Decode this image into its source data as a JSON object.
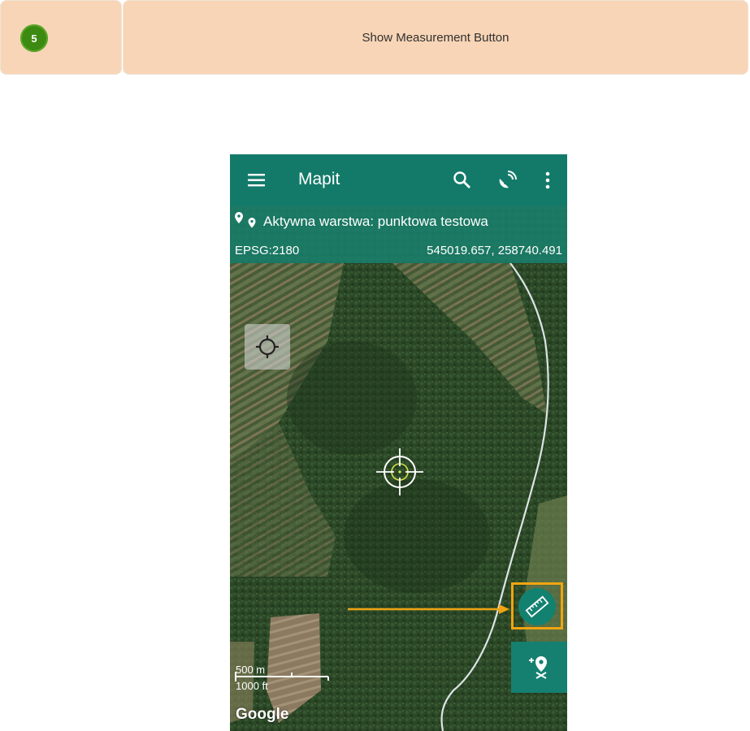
{
  "step": {
    "number": "5",
    "title": "Show Measurement Button"
  },
  "app": {
    "title": "Mapit",
    "icons": [
      "hamburger-menu-icon",
      "search-icon",
      "satellite-dish-icon",
      "more-vert-icon"
    ]
  },
  "layer_bar": {
    "active_layer": "Aktywna warstwa: punktowa testowa",
    "epsg": "EPSG:2180",
    "coordinates": "545019.657, 258740.491"
  },
  "map": {
    "scale_metric": "500 m",
    "scale_imperial": "1000 ft",
    "attribution": "Google",
    "colors": {
      "forest": "#2e4a28",
      "field": "#7b6c4e",
      "road": "#dde3e6"
    }
  },
  "buttons": {
    "locate": "gps-locate-icon",
    "measure": "ruler-icon",
    "add_point": "add-location-icon"
  },
  "colors": {
    "appbar": "#137a6a",
    "highlight": "#f1a411",
    "badge": "#3d8a10",
    "banner": "#f8d5b6"
  }
}
